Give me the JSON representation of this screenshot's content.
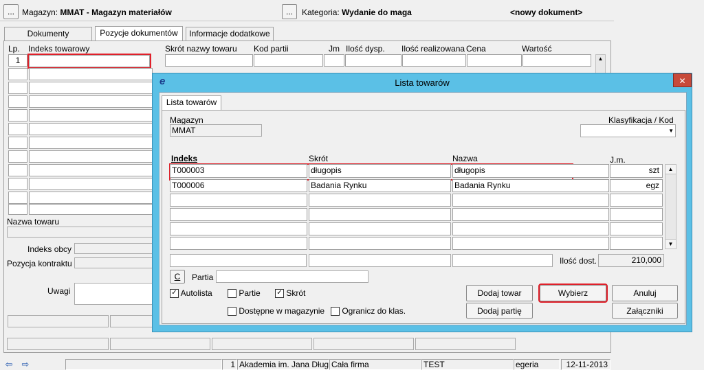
{
  "header": {
    "magazyn_prefix": "Magazyn:",
    "magazyn_value": "MMAT - Magazyn materiałów",
    "kategoria_prefix": "Kategoria:",
    "kategoria_value": "Wydanie do maga",
    "new_doc": "<nowy dokument>",
    "dots": "..."
  },
  "tabs": [
    "Dokumenty",
    "Pozycje dokumentów",
    "Informacje dodatkowe"
  ],
  "grid": {
    "headers": [
      "Lp.",
      "Indeks towarowy",
      "Skrót nazwy towaru",
      "Kod partii",
      "Jm",
      "Ilość dysp.",
      "Ilość realizowana",
      "Cena",
      "Wartość"
    ],
    "first_lp": "1"
  },
  "left_form": {
    "nazwa_towaru": "Nazwa towaru",
    "indeks_obcy": "Indeks obcy",
    "pozycja_kontraktu": "Pozycja kontraktu",
    "uwagi": "Uwagi"
  },
  "statusbar": [
    "1",
    "Akademia im. Jana Dług",
    "Cała firma",
    "TEST",
    "egeria",
    "12-11-2013"
  ],
  "dialog": {
    "title": "Lista towarów",
    "close": "✕",
    "logo": "e",
    "tab": "Lista towarów",
    "magazyn_label": "Magazyn",
    "magazyn_value": "MMAT",
    "klasyfikacja_label": "Klasyfikacja / Kod",
    "columns": [
      "Indeks",
      "Skrót",
      "Nazwa",
      "J.m."
    ],
    "rows": [
      {
        "indeks": "T000003",
        "skrot": "długopis",
        "nazwa": "długopis",
        "jm": "szt"
      },
      {
        "indeks": "T000006",
        "skrot": "Badania Rynku",
        "nazwa": "Badania Rynku",
        "jm": "egz"
      }
    ],
    "ilosc_label": "Ilość dost.",
    "ilosc_value": "210,000",
    "c_button": "C",
    "partia_label": "Partia",
    "checks": {
      "autolista": "Autolista",
      "partie": "Partie",
      "skrot": "Skrót",
      "dostepne": "Dostępne w magazynie",
      "ogranicz": "Ogranicz do klas."
    },
    "buttons": {
      "dodaj_towar": "Dodaj towar",
      "wybierz": "Wybierz",
      "anuluj": "Anuluj",
      "dodaj_partie": "Dodaj partię",
      "zalaczniki": "Załączniki"
    }
  }
}
